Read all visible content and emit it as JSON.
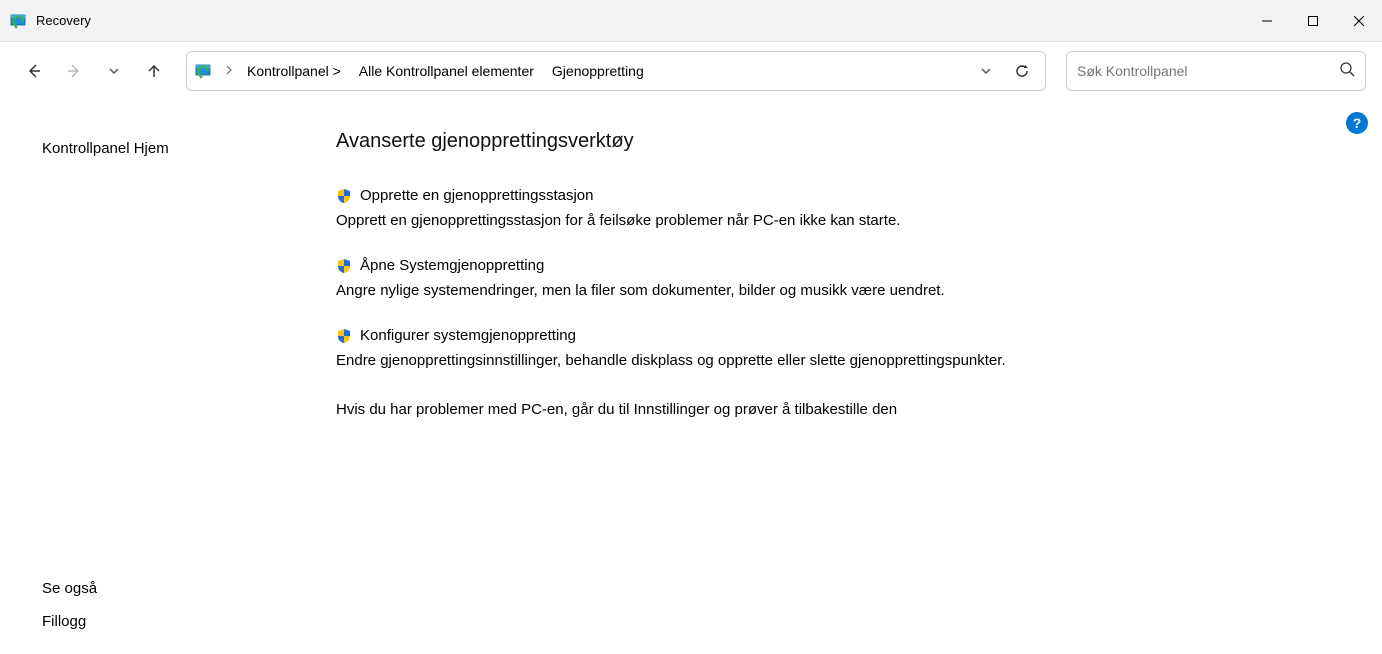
{
  "window": {
    "title": "Recovery"
  },
  "breadcrumb": {
    "seg1": "Kontrollpanel >",
    "seg2": "Alle Kontrollpanel elementer",
    "seg3": "Gjenoppretting"
  },
  "search": {
    "placeholder": "Søk Kontrollpanel"
  },
  "sidebar": {
    "home": "Kontrollpanel Hjem",
    "see_also_title": "Se også",
    "see_also_link": "Fillogg"
  },
  "content": {
    "heading": "Avanserte gjenopprettingsverktøy",
    "options": [
      {
        "link": "Opprette en gjenopprettingsstasjon",
        "desc": "Opprett en gjenopprettingsstasjon for å feilsøke problemer når PC-en ikke kan starte."
      },
      {
        "link": "Åpne Systemgjenoppretting",
        "desc": "Angre nylige systemendringer, men la filer som dokumenter, bilder og musikk være uendret."
      },
      {
        "link": "Konfigurer systemgjenoppretting",
        "desc": "Endre gjenopprettingsinnstillinger, behandle diskplass og opprette eller slette gjenopprettingspunkter."
      }
    ],
    "footer": "Hvis du har problemer med PC-en, går du til Innstillinger og prøver å tilbakestille den"
  },
  "help": {
    "label": "?"
  }
}
